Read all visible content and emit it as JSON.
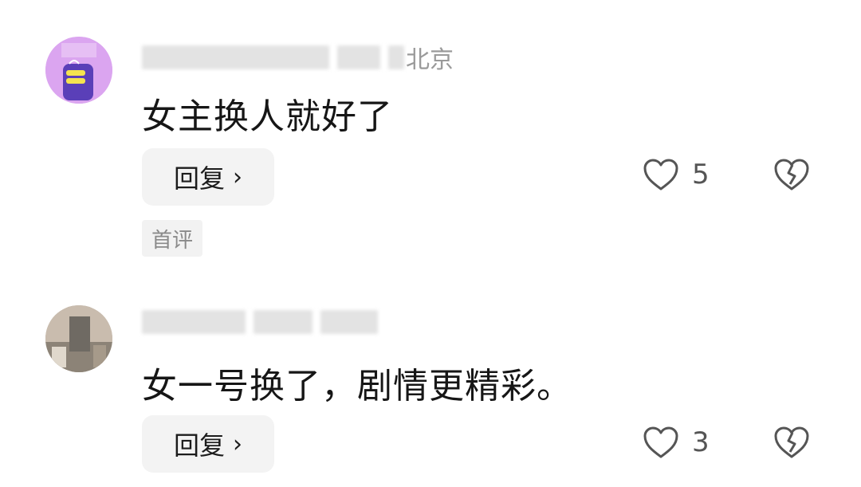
{
  "comments": [
    {
      "location": "北京",
      "text": "女主换人就好了",
      "reply_label": "回复",
      "reply_chevron": "›",
      "likes": "5",
      "tag": "首评"
    },
    {
      "location": "",
      "text": "女一号换了，剧情更精彩。",
      "reply_label": "回复",
      "reply_chevron": "›",
      "likes": "3"
    }
  ],
  "icons": {
    "like": "heart-outline-icon",
    "dislike": "broken-heart-icon",
    "reply_chevron": "chevron-right-icon"
  },
  "colors": {
    "text": "#161616",
    "meta": "#9a9a9a",
    "button_bg": "#f3f3f3",
    "icon": "#555555"
  }
}
